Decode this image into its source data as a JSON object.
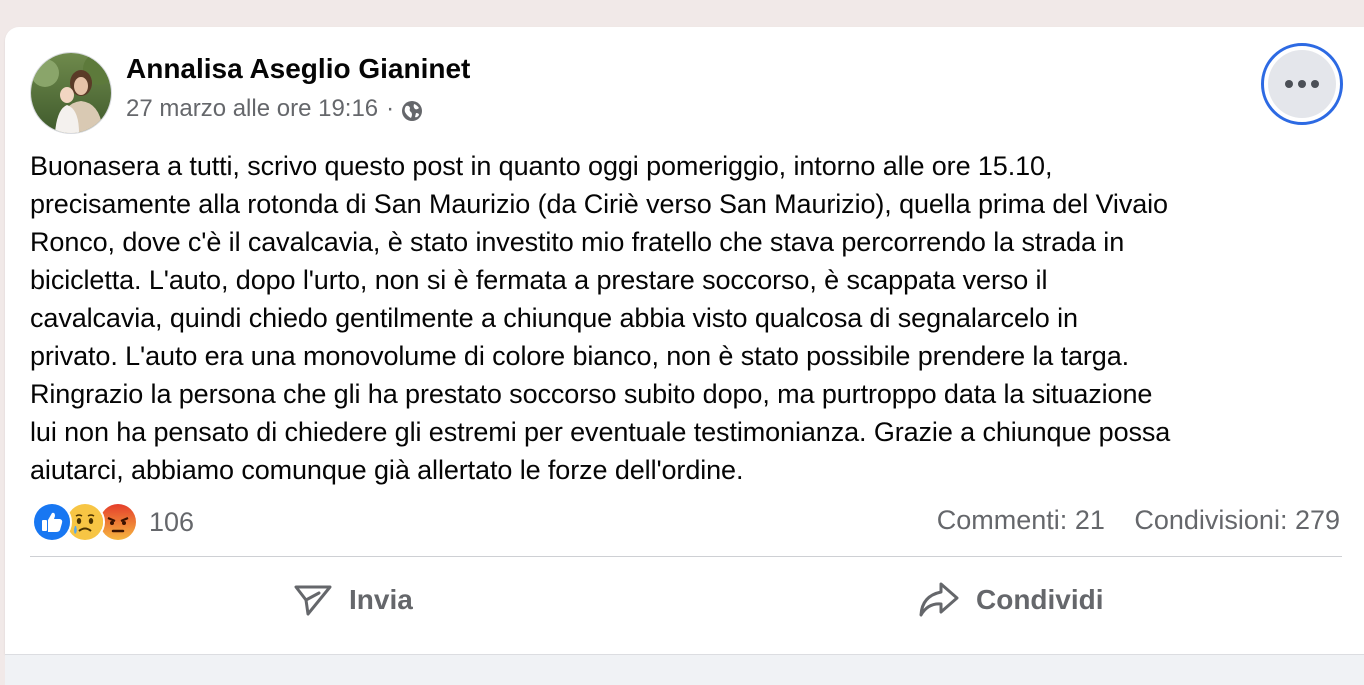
{
  "post": {
    "author": "Annalisa Aseglio Gianinet",
    "timestamp": "27 marzo alle ore 19:16",
    "separator": "·",
    "privacy_icon": "globe-icon",
    "more_icon": "more-horizontal-icon",
    "lines": [
      "Buonasera a tutti, scrivo questo post in quanto oggi pomeriggio, intorno alle ore 15.10,",
      "precisamente alla rotonda di San Maurizio (da Ciriè verso San Maurizio), quella prima del Vivaio",
      "Ronco, dove c'è il cavalcavia, è stato investito mio fratello che stava percorrendo la strada in",
      "bicicletta. L'auto, dopo l'urto, non si è fermata a prestare soccorso, è scappata verso il",
      "cavalcavia, quindi chiedo gentilmente a chiunque abbia visto qualcosa di segnalarcelo in",
      "privato. L'auto era una monovolume di colore bianco, non è stato possibile prendere la targa.",
      "Ringrazio la persona che gli ha prestato soccorso subito dopo, ma purtroppo data la situazione",
      "lui non ha pensato di chiedere gli estremi per eventuale testimonianza. Grazie a chiunque possa",
      "aiutarci, abbiamo comunque già allertato le forze dell'ordine."
    ]
  },
  "reactions": {
    "icons": [
      "like-icon",
      "sad-icon",
      "angry-icon"
    ],
    "count": "106"
  },
  "stats": {
    "comments": "Commenti: 21",
    "shares": "Condivisioni: 279"
  },
  "actions": {
    "send_label": "Invia",
    "send_icon": "send-icon",
    "share_label": "Condividi",
    "share_icon": "share-icon"
  },
  "colors": {
    "text_primary": "#050505",
    "text_secondary": "#65676b",
    "focus_ring": "#2d6ae3",
    "like_blue": "#1877f2",
    "angry_red": "#e9710f"
  }
}
